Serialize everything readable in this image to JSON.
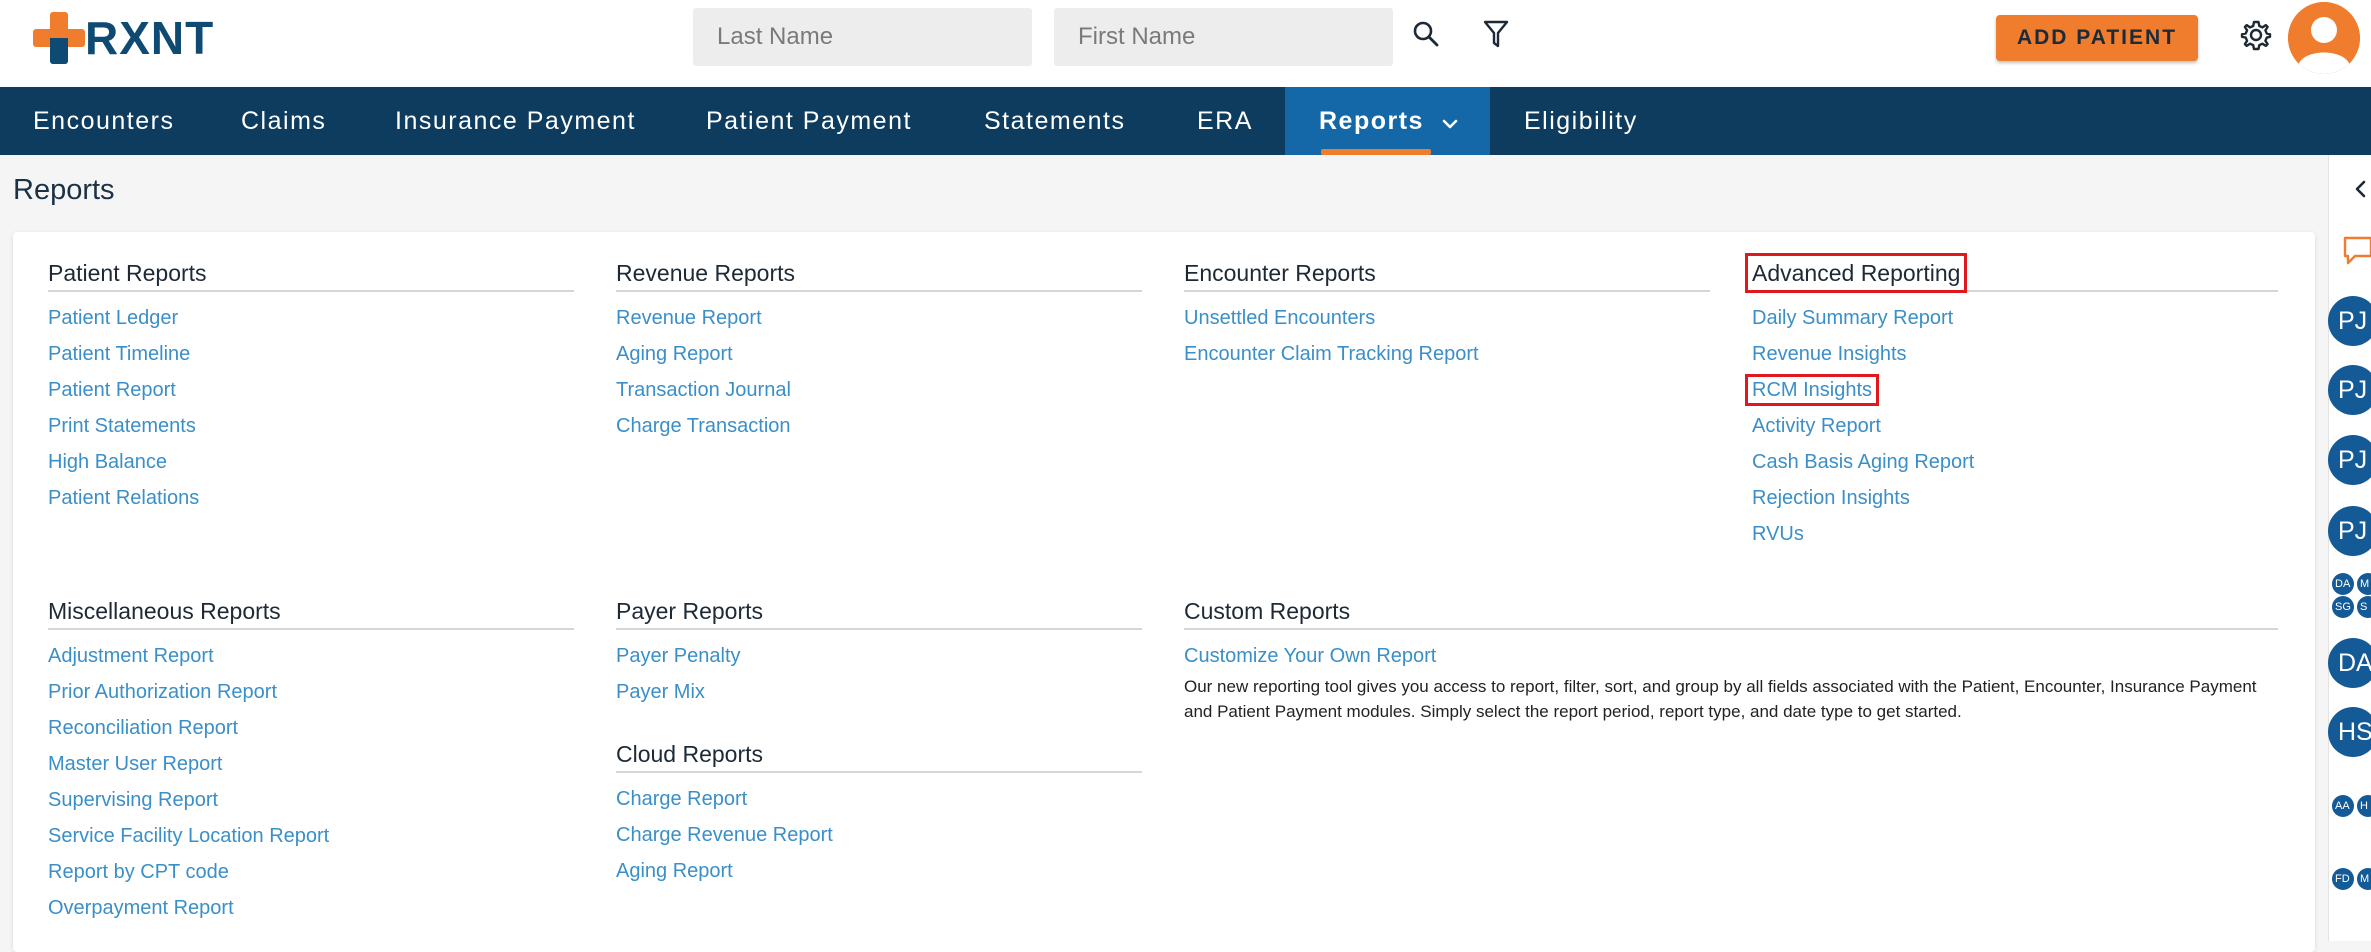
{
  "header": {
    "logo_text": "RXNT",
    "last_name_placeholder": "Last Name",
    "first_name_placeholder": "First Name",
    "add_patient_label": "ADD PATIENT"
  },
  "nav": {
    "items": [
      "Encounters",
      "Claims",
      "Insurance Payment",
      "Patient Payment",
      "Statements",
      "ERA",
      "Reports",
      "Eligibility"
    ],
    "active": "Reports"
  },
  "page": {
    "title": "Reports"
  },
  "sections": {
    "patient": {
      "title": "Patient Reports",
      "links": [
        "Patient Ledger",
        "Patient Timeline",
        "Patient Report",
        "Print Statements",
        "High Balance",
        "Patient Relations"
      ]
    },
    "revenue": {
      "title": "Revenue Reports",
      "links": [
        "Revenue Report",
        "Aging Report",
        "Transaction Journal",
        "Charge Transaction"
      ]
    },
    "encounter": {
      "title": "Encounter Reports",
      "links": [
        "Unsettled Encounters",
        "Encounter Claim Tracking Report"
      ]
    },
    "advanced": {
      "title": "Advanced Reporting",
      "links": [
        "Daily Summary Report",
        "Revenue Insights",
        "RCM Insights",
        "Activity Report",
        "Cash Basis Aging Report",
        "Rejection Insights",
        "RVUs"
      ]
    },
    "misc": {
      "title": "Miscellaneous Reports",
      "links": [
        "Adjustment Report",
        "Prior Authorization Report",
        "Reconciliation Report",
        "Master User Report",
        "Supervising Report",
        "Service Facility Location Report",
        "Report by CPT code",
        "Overpayment Report"
      ]
    },
    "payer": {
      "title": "Payer Reports",
      "links": [
        "Payer Penalty",
        "Payer Mix"
      ]
    },
    "cloud": {
      "title": "Cloud Reports",
      "links": [
        "Charge Report",
        "Charge Revenue Report",
        "Aging Report"
      ]
    },
    "custom": {
      "title": "Custom Reports",
      "link": "Customize Your Own Report",
      "description": "Our new reporting tool gives you access to report, filter, sort, and group by all fields associated with the Patient, Encounter, Insurance Payment and Patient Payment modules. Simply select the report period, report type, and date type to get started."
    }
  },
  "rail": {
    "bubbles_big": [
      "PJ",
      "PJ",
      "PJ",
      "PJ",
      "DA",
      "HS"
    ],
    "bubbles_small": [
      "DA",
      "M",
      "SG",
      "S",
      "AA",
      "H",
      "FD",
      "M"
    ]
  },
  "colors": {
    "brand_orange": "#f07c2e",
    "brand_navy": "#0d3c5e",
    "nav_active": "#1468a8",
    "link_blue": "#3a8fc8",
    "highlight_red": "#e0191f"
  }
}
